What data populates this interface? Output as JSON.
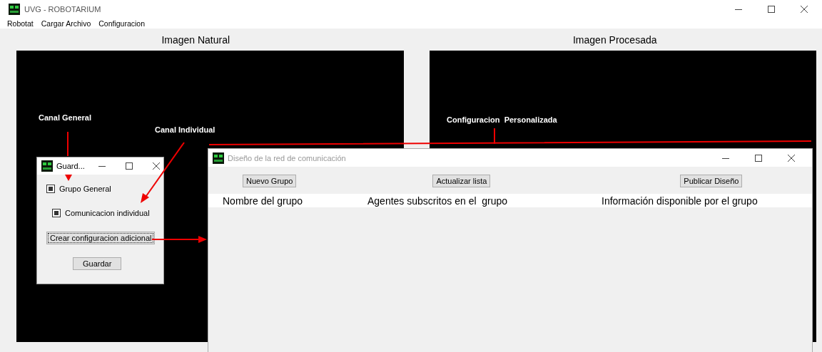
{
  "main_window": {
    "title": "UVG - ROBOTARIUM",
    "menu": [
      "Robotat",
      "Cargar Archivo",
      "Configuracion"
    ],
    "panels": [
      {
        "label": "Imagen Natural"
      },
      {
        "label": "Imagen Procesada"
      }
    ]
  },
  "annotations": [
    {
      "text": "Canal General"
    },
    {
      "text": "Canal Individual"
    },
    {
      "text": "Configuracion  Personalizada"
    }
  ],
  "save_dialog": {
    "title": "Guard...",
    "checkboxes": [
      {
        "label": "Grupo General",
        "checked": true
      },
      {
        "label": "Comunicacion individual",
        "checked": true
      }
    ],
    "buttons": [
      {
        "label": "Crear configuracion adicional",
        "focused": true
      },
      {
        "label": "Guardar",
        "focused": false
      }
    ]
  },
  "design_dialog": {
    "title": "Diseño de la red de comunicación",
    "active": false,
    "buttons": [
      "Nuevo Grupo",
      "Actualizar lista",
      "Publicar Diseño"
    ],
    "columns": [
      "Nombre del grupo",
      "Agentes subscritos en el  grupo",
      "Información disponible por el grupo"
    ]
  }
}
